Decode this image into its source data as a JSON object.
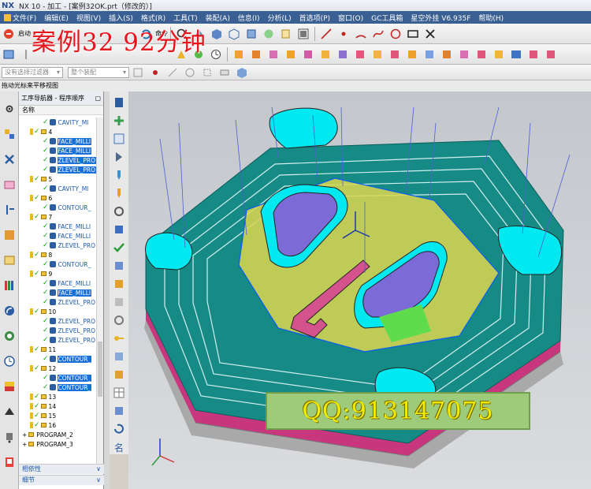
{
  "window": {
    "logo": "NX",
    "title": "NX 10 - 加工 - [案例32OK.prt（修改的）]"
  },
  "menu": [
    "文件(F)",
    "编辑(E)",
    "视图(V)",
    "插入(S)",
    "格式(R)",
    "工具(T)",
    "装配(A)",
    "信息(I)",
    "分析(L)",
    "首选项(P)",
    "窗口(O)",
    "GC工具箱",
    "星空外挂 V6.935F",
    "帮助(H)"
  ],
  "toolbar": {
    "start_label": "启动",
    "command_label": "命令",
    "selection_filter": "没有选择过滤器",
    "assembly_scope": "整个装配"
  },
  "watermark": {
    "title": "案例32  92分钟",
    "qq": "QQ:913147075"
  },
  "hint": "拖动光标来平移视图",
  "navigator": {
    "title": "工序导航器 - 程序顺序",
    "column": "名称",
    "rows": [
      {
        "label": "CAVITY_MI",
        "level": 3,
        "kind": "op",
        "selected": false
      },
      {
        "label": "4",
        "level": 2,
        "kind": "group",
        "selected": false
      },
      {
        "label": "FACE_MILLI",
        "level": 3,
        "kind": "op",
        "selected": true
      },
      {
        "label": "FACE_MILLI",
        "level": 3,
        "kind": "op",
        "selected": true
      },
      {
        "label": "ZLEVEL_PRO",
        "level": 3,
        "kind": "op",
        "selected": true
      },
      {
        "label": "ZLEVEL_PRO",
        "level": 3,
        "kind": "op",
        "selected": true
      },
      {
        "label": "5",
        "level": 2,
        "kind": "group",
        "selected": false
      },
      {
        "label": "CAVITY_MI",
        "level": 3,
        "kind": "op",
        "selected": false
      },
      {
        "label": "6",
        "level": 2,
        "kind": "group",
        "selected": false
      },
      {
        "label": "CONTOUR_",
        "level": 3,
        "kind": "op",
        "selected": false
      },
      {
        "label": "7",
        "level": 2,
        "kind": "group",
        "selected": false
      },
      {
        "label": "FACE_MILLI",
        "level": 3,
        "kind": "op",
        "selected": false
      },
      {
        "label": "FACE_MILLI",
        "level": 3,
        "kind": "op",
        "selected": false
      },
      {
        "label": "ZLEVEL_PRO",
        "level": 3,
        "kind": "op",
        "selected": false
      },
      {
        "label": "8",
        "level": 2,
        "kind": "group",
        "selected": false
      },
      {
        "label": "CONTOUR_",
        "level": 3,
        "kind": "op",
        "selected": false
      },
      {
        "label": "9",
        "level": 2,
        "kind": "group",
        "selected": false
      },
      {
        "label": "FACE_MILLI",
        "level": 3,
        "kind": "op",
        "selected": false
      },
      {
        "label": "FACE_MILLI",
        "level": 3,
        "kind": "op",
        "selected": true
      },
      {
        "label": "ZLEVEL_PRO",
        "level": 3,
        "kind": "op",
        "selected": false
      },
      {
        "label": "10",
        "level": 2,
        "kind": "group",
        "selected": false
      },
      {
        "label": "ZLEVEL_PRO",
        "level": 3,
        "kind": "op",
        "selected": false
      },
      {
        "label": "ZLEVEL_PRO",
        "level": 3,
        "kind": "op",
        "selected": false
      },
      {
        "label": "ZLEVEL_PRO",
        "level": 3,
        "kind": "op",
        "selected": false
      },
      {
        "label": "11",
        "level": 2,
        "kind": "group",
        "selected": false
      },
      {
        "label": "CONTOUR_",
        "level": 3,
        "kind": "op",
        "selected": true
      },
      {
        "label": "12",
        "level": 2,
        "kind": "group",
        "selected": false
      },
      {
        "label": "CONTOUR_",
        "level": 3,
        "kind": "op",
        "selected": true
      },
      {
        "label": "CONTOUR_",
        "level": 3,
        "kind": "op",
        "selected": true
      },
      {
        "label": "13",
        "level": 2,
        "kind": "group",
        "selected": false
      },
      {
        "label": "14",
        "level": 2,
        "kind": "group",
        "selected": false
      },
      {
        "label": "15",
        "level": 2,
        "kind": "group",
        "selected": false
      },
      {
        "label": "16",
        "level": 2,
        "kind": "group",
        "selected": false
      },
      {
        "label": "PROGRAM_2",
        "level": 1,
        "kind": "program",
        "selected": false
      },
      {
        "label": "PROGRAM_3",
        "level": 1,
        "kind": "program",
        "selected": false
      }
    ],
    "panels": [
      "相依性",
      "细节"
    ]
  },
  "colors": {
    "menu_bg": "#3a5f92",
    "selection": "#1a6fd8",
    "part_top": "#168a85",
    "toolpath": "#00e8f0",
    "boss": "#7c6bd6",
    "watermark_red": "#e8141c",
    "qq_banner": "#9dcb7a"
  }
}
